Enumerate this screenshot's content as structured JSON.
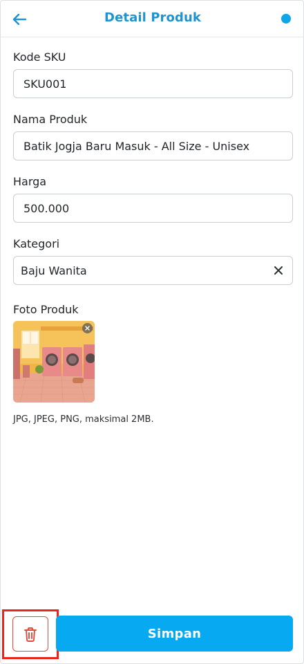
{
  "header": {
    "title": "Detail Produk",
    "back_icon": "arrow-left-icon",
    "status_dot_color": "#0ea5e9",
    "accent": "#1d93d2"
  },
  "form": {
    "sku": {
      "label": "Kode SKU",
      "value": "SKU001"
    },
    "name": {
      "label": "Nama Produk",
      "value": "Batik Jogja Baru Masuk - All Size - Unisex"
    },
    "price": {
      "label": "Harga",
      "value": "500.000"
    },
    "category": {
      "label": "Kategori",
      "value": "Baju Wanita",
      "clear_icon": "close-icon"
    },
    "photo": {
      "label": "Foto Produk",
      "hint": "JPG, JPEG, PNG, maksimal 2MB.",
      "remove_icon": "close-icon"
    }
  },
  "footer": {
    "delete_icon": "trash-icon",
    "delete_color": "#e14b3b",
    "save_label": "Simpan",
    "save_color": "#07a9f0"
  }
}
